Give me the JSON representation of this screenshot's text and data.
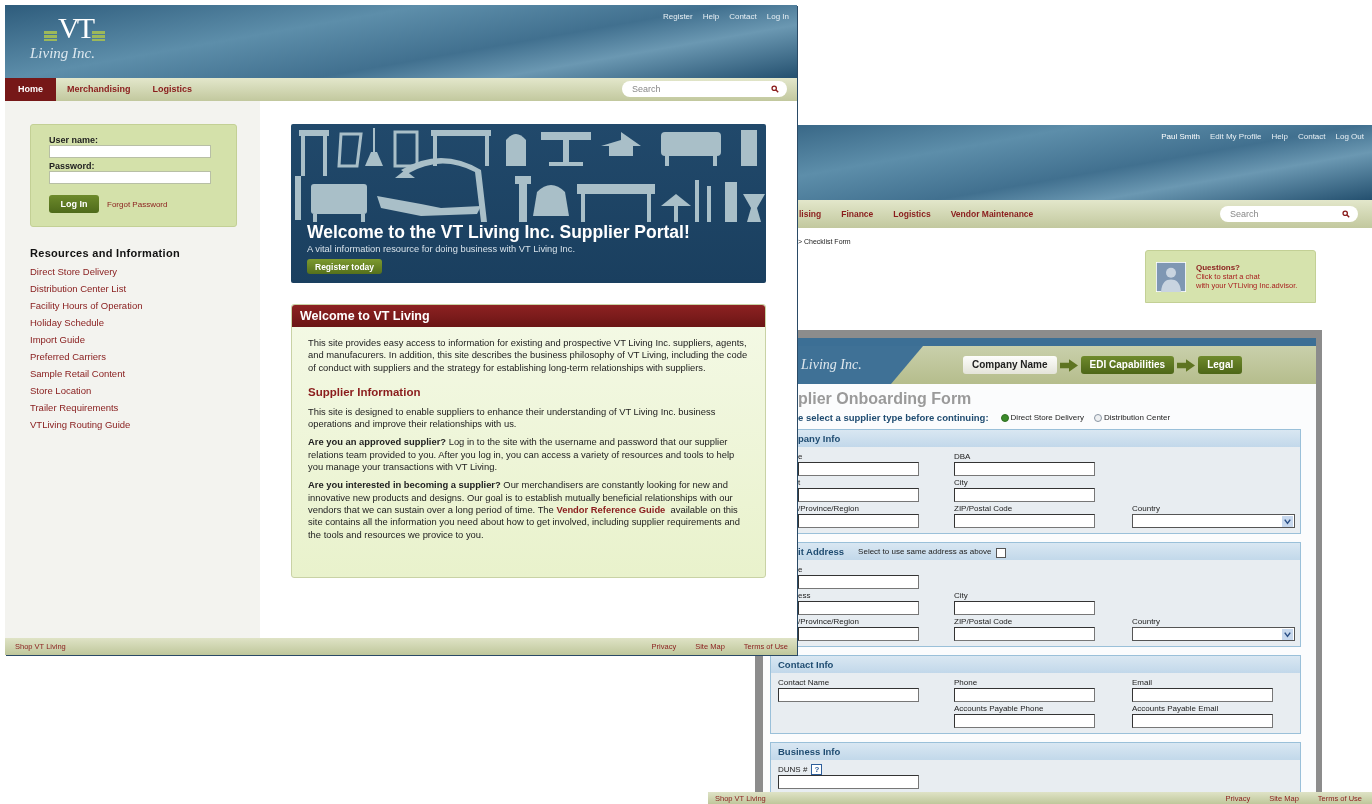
{
  "front_window": {
    "logo": {
      "monogram": "VT",
      "script": "Living Inc."
    },
    "top_links": [
      "Register",
      "Help",
      "Contact",
      "Log In"
    ],
    "nav": [
      {
        "label": "Home",
        "selected": true
      },
      {
        "label": "Merchandising",
        "selected": false
      },
      {
        "label": "Logistics",
        "selected": false
      }
    ],
    "search": {
      "placeholder": "Search"
    },
    "login": {
      "username_label": "User name:",
      "password_label": "Password:",
      "button": "Log In",
      "forgot_link": "Forgot Password"
    },
    "resources": {
      "title": "Resources and Information",
      "links": [
        "Direct Store Delivery",
        "Distribution Center List",
        "Facility Hours of Operation",
        "Holiday Schedule",
        "Import Guide",
        "Preferred Carriers",
        "Sample Retail Content",
        "Store Location",
        "Trailer Requirements",
        "VTLiving Routing Guide"
      ]
    },
    "hero": {
      "title": "Welcome to the VT Living Inc. Supplier Portal!",
      "subtitle": "A vital information resource for doing business with VT Living Inc.",
      "button": "Register today"
    },
    "welcome": {
      "title": "Welcome to VT Living",
      "intro": "This site provides easy access to information for existing and prospective VT Living Inc. suppliers, agents, and manufacurers. In addition, this site describes the business philosophy of VT Living, including the code of conduct with suppliers and the strategy for establishing long-term relationships with suppliers.",
      "section_title": "Supplier Information",
      "paragraphs": [
        {
          "text": "This site is designed to enable suppliers to enhance their understanding of VT Living Inc. business operations and improve their relationships with us."
        },
        {
          "text": "**Are you an approved supplier?** Log in to the site with the username and password that our supplier relations team provided to you. After you log in, you can access a variety of resources and tools to help you manage your transactions with VT Living."
        },
        {
          "text": "**Are you interested in becoming a supplier?** Our merchandisers are constantly looking for new and innovative new products and designs. Our goal is to establish mutually beneficial relationships with our vendors that we can sustain over a long period of time. The",
          "link": "Vendor Reference Guide",
          "after": "available on this site contains all the information you need about how to get involved, including supplier requirements and the tools and resources we provice to you."
        }
      ]
    },
    "footer": {
      "left": "Shop VT Living",
      "links": [
        "Privacy",
        "Site Map",
        "Terms of Use"
      ]
    }
  },
  "back_window": {
    "user": "Paul Smith",
    "top_links": [
      "Edit My Profile",
      "Help",
      "Contact",
      "Log Out"
    ],
    "nav": [
      {
        "label": "lising",
        "selected": false
      },
      {
        "label": "Finance",
        "selected": false
      },
      {
        "label": "Logistics",
        "selected": false
      },
      {
        "label": "Vendor Maintenance",
        "selected": false
      }
    ],
    "search": {
      "placeholder": "Search"
    },
    "breadcrumb": "> Checklist Form",
    "chat": {
      "title": "Questions?",
      "line1": "Click to start a chat",
      "line2": "with your VTLiving Inc.advisor."
    },
    "form": {
      "logo_script": "Living Inc.",
      "steps": [
        {
          "label": "Company Name",
          "selected": true
        },
        {
          "label": "EDI Capabilities",
          "selected": false
        },
        {
          "label": "Legal",
          "selected": false
        }
      ],
      "title": "plier Onboarding Form",
      "prompt": "e select a supplier type before continuing:",
      "supplier_types": [
        {
          "label": "Direct Store Delivery",
          "selected": true
        },
        {
          "label": "Distribution Center",
          "selected": false
        }
      ],
      "sections": [
        {
          "title": "pany Info",
          "rows": [
            [
              {
                "kind": "text",
                "label": "e"
              },
              {
                "kind": "text",
                "label": "DBA"
              }
            ],
            [
              {
                "kind": "text",
                "label": "t"
              },
              {
                "kind": "text",
                "label": "City"
              }
            ],
            [
              {
                "kind": "text",
                "label": "/Province/Region"
              },
              {
                "kind": "text",
                "label": "ZIP/Postal Code"
              },
              {
                "kind": "select",
                "label": "Country"
              }
            ]
          ]
        },
        {
          "title": "it Address",
          "same_address": {
            "label": "Select to use same address as above",
            "checked": false
          },
          "rows": [
            [
              {
                "kind": "text",
                "label": "e"
              }
            ],
            [
              {
                "kind": "text",
                "label": "ess"
              },
              {
                "kind": "text",
                "label": "City"
              }
            ],
            [
              {
                "kind": "text",
                "label": "/Province/Region"
              },
              {
                "kind": "text",
                "label": "ZIP/Postal Code"
              },
              {
                "kind": "select",
                "label": "Country"
              }
            ]
          ]
        },
        {
          "title": "Contact Info",
          "rows": [
            [
              {
                "kind": "text",
                "label": "Contact Name"
              },
              {
                "kind": "text",
                "label": "Phone"
              },
              {
                "kind": "text",
                "label": "Email"
              }
            ],
            [
              {
                "kind": "empty"
              },
              {
                "kind": "text",
                "label": "Accounts Payable Phone"
              },
              {
                "kind": "text",
                "label": "Accounts Payable Email"
              }
            ]
          ]
        },
        {
          "title": "Business Info",
          "rows": [
            [
              {
                "kind": "text",
                "label": "DUNS #",
                "help": "?"
              }
            ]
          ]
        }
      ]
    },
    "footer": {
      "left": "Shop VT Living",
      "links": [
        "Privacy",
        "Site Map",
        "Terms of Use"
      ]
    }
  }
}
